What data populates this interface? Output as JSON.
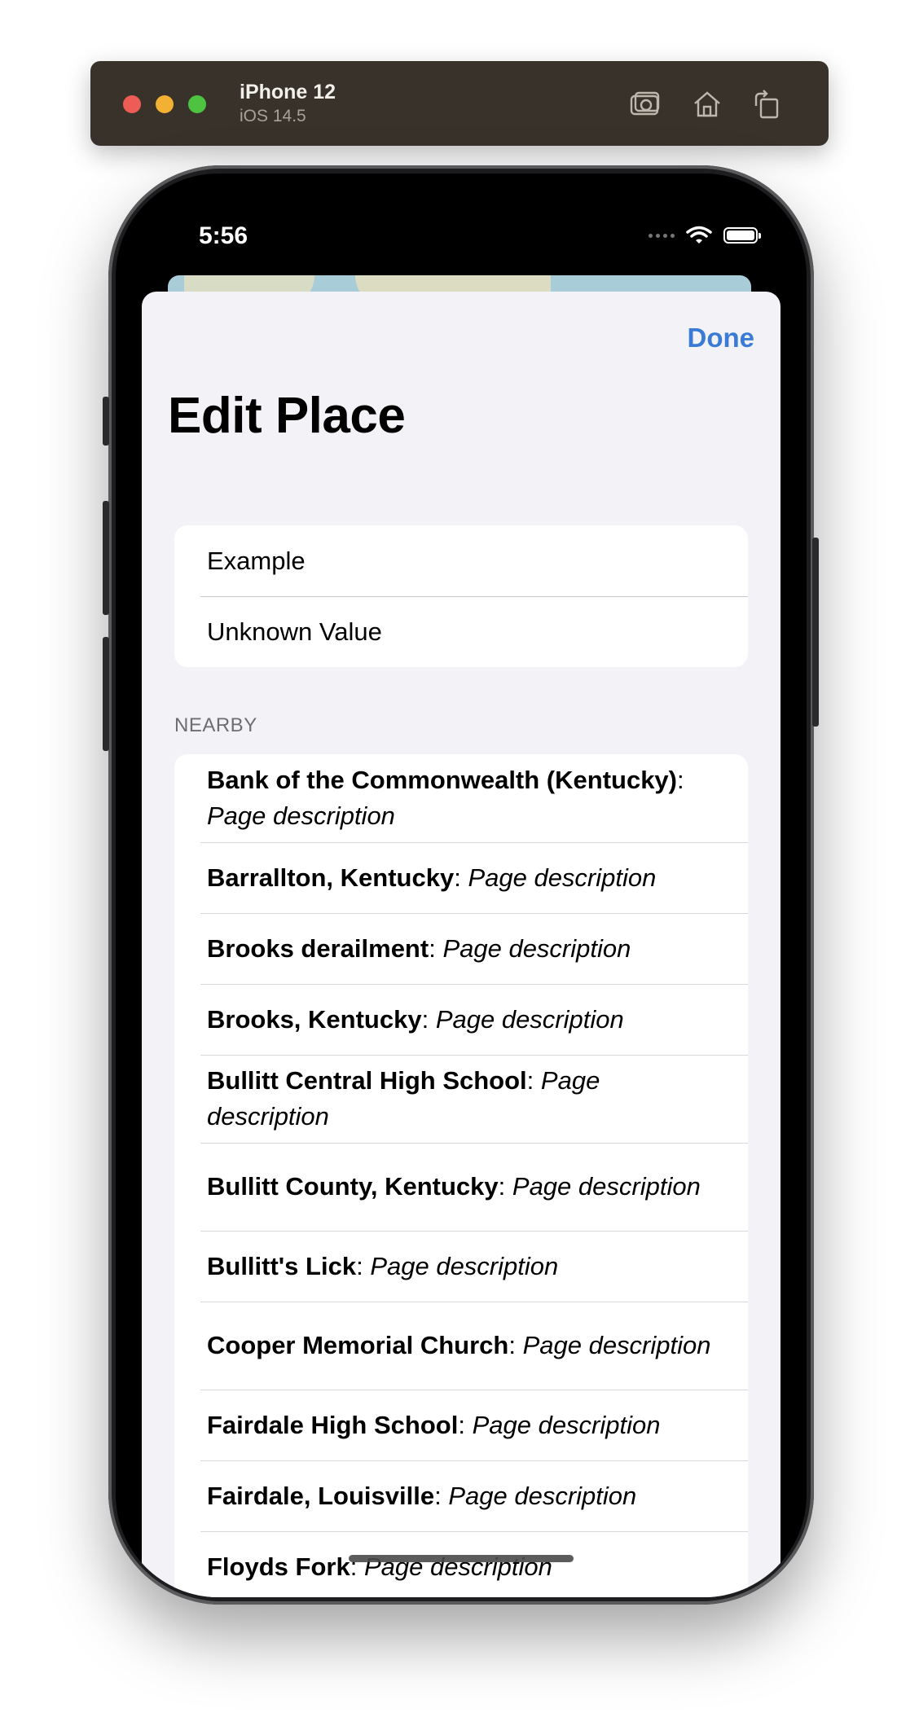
{
  "simulator": {
    "device_name": "iPhone 12",
    "os_version": "iOS 14.5",
    "icons": [
      "screenshot-icon",
      "home-icon",
      "rotate-icon"
    ]
  },
  "status_bar": {
    "time": "5:56"
  },
  "header": {
    "done_label": "Done",
    "title": "Edit Place"
  },
  "fields": {
    "name": "Example",
    "value": "Unknown Value"
  },
  "nearby": {
    "section_label": "NEARBY",
    "items": [
      {
        "title": "Bank of the Commonwealth (Kentucky)",
        "desc": "Page description"
      },
      {
        "title": "Barrallton, Kentucky",
        "desc": "Page description"
      },
      {
        "title": "Brooks derailment",
        "desc": "Page description"
      },
      {
        "title": "Brooks, Kentucky",
        "desc": "Page description"
      },
      {
        "title": "Bullitt Central High School",
        "desc": "Page description"
      },
      {
        "title": "Bullitt County, Kentucky",
        "desc": "Page description"
      },
      {
        "title": "Bullitt's Lick",
        "desc": "Page description"
      },
      {
        "title": "Cooper Memorial Church",
        "desc": "Page description"
      },
      {
        "title": "Fairdale High School",
        "desc": "Page description"
      },
      {
        "title": "Fairdale, Louisville",
        "desc": "Page description"
      },
      {
        "title": "Floyds Fork",
        "desc": "Page description"
      }
    ]
  },
  "colors": {
    "accent": "#3a7bd5",
    "sheet_background": "#f2f2f7",
    "toolbar": "#38322a"
  }
}
